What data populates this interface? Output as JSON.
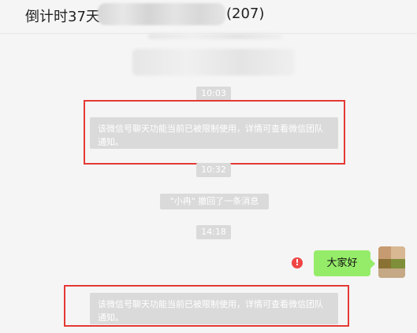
{
  "header": {
    "title_prefix": "倒计时37天",
    "title_count": "(207)"
  },
  "chat": {
    "times": [
      "10:03",
      "10:32",
      "14:18"
    ],
    "notice_text": "该微信号聊天功能当前已被限制使用，详情可查看微信团队通知。",
    "recall_text": "\"小冉\" 撤回了一条消息",
    "my_message": "大家好",
    "error_glyph": "!"
  },
  "colors": {
    "background": "#f5f5f5",
    "bubble_green": "#95ec69",
    "highlight_red": "#e53935",
    "system_pill": "#dadada"
  }
}
